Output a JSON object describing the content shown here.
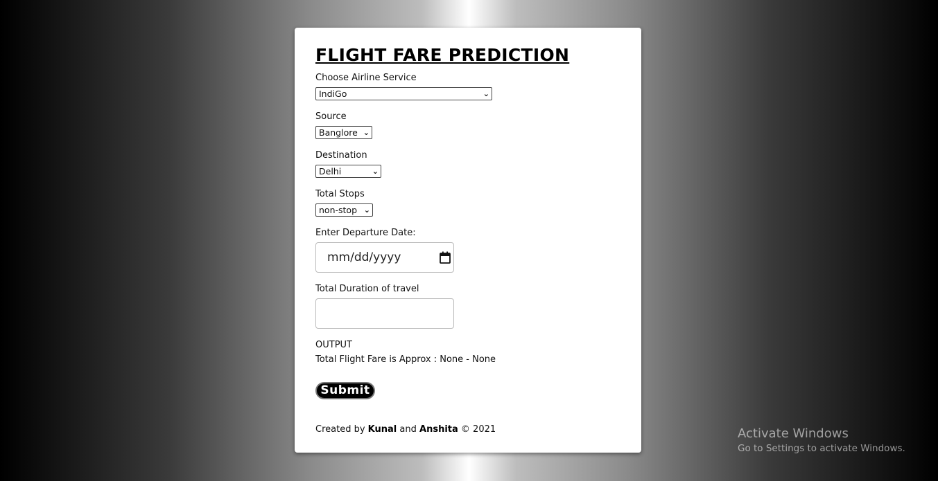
{
  "form": {
    "title": "FLIGHT FARE PREDICTION",
    "airline_label": "Choose Airline Service",
    "airline_value": "IndiGo",
    "source_label": "Source",
    "source_value": "Banglore",
    "destination_label": "Destination",
    "destination_value": "Delhi",
    "stops_label": "Total Stops",
    "stops_value": "non-stop",
    "date_label": "Enter Departure Date:",
    "date_placeholder": "mm/dd/yyyy",
    "duration_label": "Total Duration of travel",
    "duration_value": "",
    "output_label": "OUTPUT",
    "output_text": "Total Flight Fare is Approx : None - None",
    "submit_label": "Submit"
  },
  "footer": {
    "prefix": "Created by",
    "author1": "Kunal",
    "and": "and",
    "author2": "Anshita",
    "copyright": "© 2021"
  },
  "watermark": {
    "line1": "Activate Windows",
    "line2": "Go to Settings to activate Windows."
  },
  "icons": {
    "dropdown": "chevron-down-icon",
    "calendar": "calendar-icon"
  }
}
